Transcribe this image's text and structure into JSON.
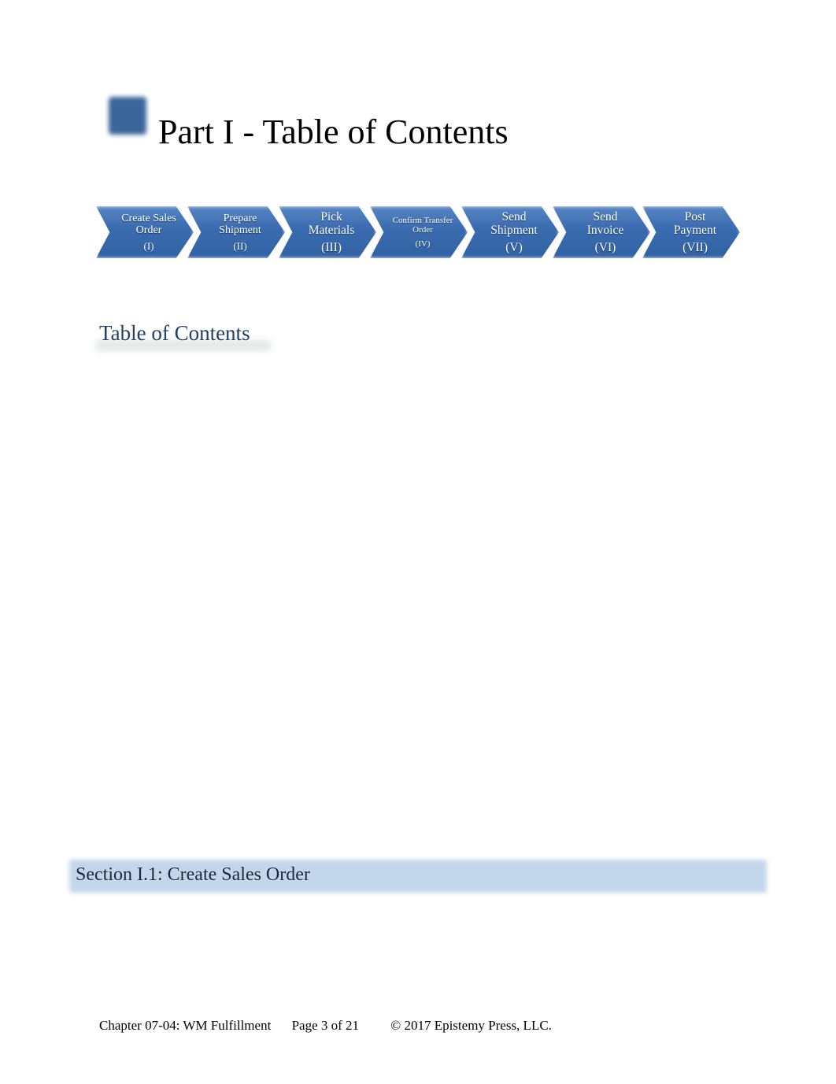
{
  "page": {
    "title": "Part I - Table of Contents",
    "marker_icon": "square-bullet-icon"
  },
  "process_flow": {
    "steps": [
      {
        "label": "Create Sales Order",
        "line1": "Create Sales",
        "line2": "Order",
        "numeral": "(I)"
      },
      {
        "label": "Prepare Shipment",
        "line1": "Prepare",
        "line2": "Shipment",
        "numeral": "(II)"
      },
      {
        "label": "Pick Materials",
        "line1": "Pick",
        "line2": "Materials",
        "numeral": "(III)"
      },
      {
        "label": "Confirm Transfer Order",
        "line1": "Confirm Transfer",
        "line2": "Order",
        "numeral": "(IV)"
      },
      {
        "label": "Send Shipment",
        "line1": "Send",
        "line2": "Shipment",
        "numeral": "(V)"
      },
      {
        "label": "Send Invoice",
        "line1": "Send",
        "line2": "Invoice",
        "numeral": "(VI)"
      },
      {
        "label": "Post Payment",
        "line1": "Post",
        "line2": "Payment",
        "numeral": "(VII)"
      }
    ],
    "color": "#2f63ab"
  },
  "toc": {
    "heading": "Table of Contents",
    "color": "#223f64"
  },
  "section": {
    "title": "Section I.1: Create Sales Order",
    "background": "#c3d6ea"
  },
  "footer": {
    "chapter": "Chapter 07-04: WM Fulfillment",
    "page": "Page 3 of 21",
    "copyright": "© 2017 Epistemy Press, LLC."
  }
}
